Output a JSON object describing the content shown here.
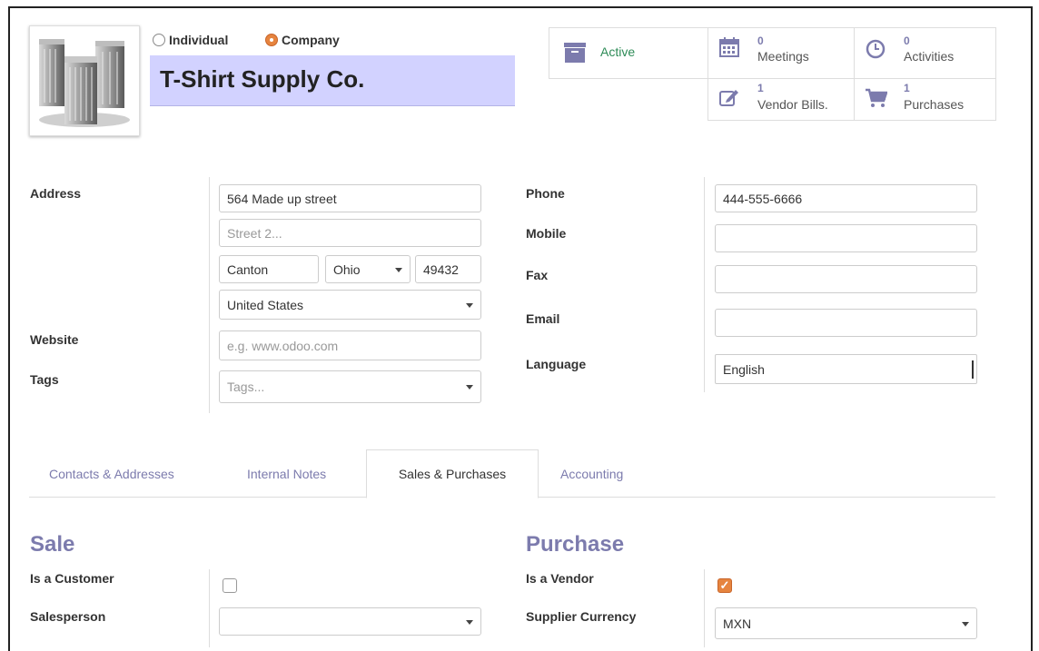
{
  "header": {
    "type_options": [
      {
        "label": "Individual",
        "selected": false
      },
      {
        "label": "Company",
        "selected": true
      }
    ],
    "partner_name": "T-Shirt Supply Co."
  },
  "smart_buttons": {
    "active": {
      "label": "Active",
      "icon": "archive-icon"
    },
    "meetings": {
      "count": "0",
      "label": "Meetings",
      "icon": "calendar-icon"
    },
    "activities": {
      "count": "0",
      "label": "Activities",
      "icon": "clock-icon"
    },
    "vendor_bills": {
      "count": "1",
      "label": "Vendor Bills.",
      "icon": "edit-icon"
    },
    "purchases": {
      "count": "1",
      "label": "Purchases",
      "icon": "cart-icon"
    }
  },
  "left_fields": {
    "address_label": "Address",
    "street": "564 Made up street",
    "street2_placeholder": "Street 2...",
    "city": "Canton",
    "state": "Ohio",
    "zip": "49432",
    "country": "United States",
    "website_label": "Website",
    "website_placeholder": "e.g. www.odoo.com",
    "tags_label": "Tags",
    "tags_placeholder": "Tags..."
  },
  "right_fields": {
    "phone_label": "Phone",
    "phone": "444-555-6666",
    "mobile_label": "Mobile",
    "mobile": "",
    "fax_label": "Fax",
    "fax": "",
    "email_label": "Email",
    "email": "",
    "language_label": "Language",
    "language": "English"
  },
  "tabs": [
    {
      "label": "Contacts & Addresses",
      "active": false
    },
    {
      "label": "Internal Notes",
      "active": false
    },
    {
      "label": "Sales & Purchases",
      "active": true
    },
    {
      "label": "Accounting",
      "active": false
    }
  ],
  "sale": {
    "title": "Sale",
    "is_customer_label": "Is a Customer",
    "is_customer": false,
    "salesperson_label": "Salesperson",
    "salesperson": ""
  },
  "purchase": {
    "title": "Purchase",
    "is_vendor_label": "Is a Vendor",
    "is_vendor": true,
    "currency_label": "Supplier Currency",
    "currency": "MXN"
  },
  "colors": {
    "accent": "#7c7bad",
    "highlight": "#e6843f",
    "name_bg": "#d2d2ff",
    "active_green": "#2e8b57"
  }
}
